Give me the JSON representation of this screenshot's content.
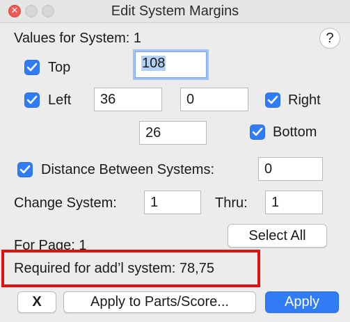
{
  "window": {
    "title": "Edit System Margins"
  },
  "icons": {
    "close": "close-icon",
    "minimize": "minimize-icon",
    "zoom": "zoom-icon",
    "help": "help-icon",
    "checkmark": "checkmark-icon"
  },
  "colors": {
    "accent": "#2f7cf6",
    "highlight": "#e01010",
    "window_bg": "#ececec"
  },
  "header": {
    "values_for_system_label": "Values for System:",
    "values_for_system_value": "1",
    "help_glyph": "?"
  },
  "margins": {
    "top": {
      "label": "Top",
      "checked": true,
      "value": "108"
    },
    "left": {
      "label": "Left",
      "checked": true,
      "value": "36"
    },
    "right": {
      "label": "Right",
      "checked": true,
      "value": "0"
    },
    "bottom": {
      "label": "Bottom",
      "checked": true,
      "value": "26"
    }
  },
  "distance": {
    "label": "Distance Between Systems:",
    "checked": true,
    "value": "0"
  },
  "change_system": {
    "label": "Change System:",
    "value": "1",
    "thru_label": "Thru:",
    "thru_value": "1"
  },
  "buttons": {
    "select_all": "Select All",
    "cancel": "X",
    "apply_to_parts": "Apply to Parts/Score...",
    "apply": "Apply"
  },
  "page": {
    "for_page_label": "For Page:",
    "for_page_value": "1",
    "required_label": "Required for add’l system:",
    "required_value": "78,75"
  }
}
